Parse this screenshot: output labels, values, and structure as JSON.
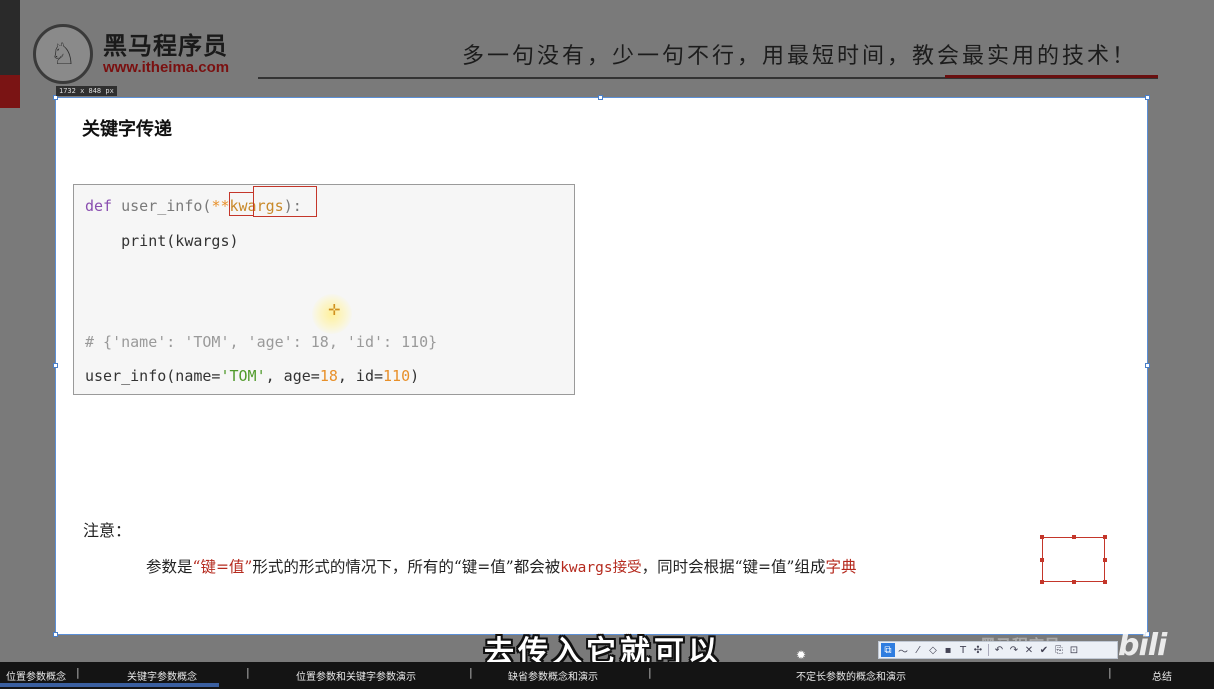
{
  "header": {
    "logo_title": "黑马程序员",
    "logo_url": "www.itheima.com",
    "slogan": "多一句没有，少一句不行，用最短时间，教会最实用的技术！",
    "size_tag": "1732 x 848 px"
  },
  "slide": {
    "title": "关键字传递",
    "code": {
      "line1": {
        "def": "def",
        "name": " user_info",
        "open": "(",
        "stars": "**",
        "param": "kwargs",
        "close": "):"
      },
      "line2": "    print(kwargs)",
      "line3": "# {'name': 'TOM', 'age': 18, 'id': 110}",
      "line4": {
        "a": "user_info(name=",
        "s1": "'TOM'",
        "b": ", age=",
        "n1": "18",
        "c": ", id=",
        "n2": "110",
        "d": ")"
      }
    },
    "note_label": "注意：",
    "note": {
      "p1": "参数是",
      "q1": "“键=值”",
      "p2": "形式的形式的情况下，所有的“键=值”都会被",
      "kw": "kwargs接受",
      "p3": "，同时会根据“键=值”组",
      "end1": "成",
      "end2": "字典"
    }
  },
  "subtitle": "去传入它就可以",
  "watermark": "黑马程序员",
  "bili": "bili",
  "toolbar": {
    "buttons": [
      "⧉",
      "〜",
      "⁄",
      "◇",
      "▪",
      "T",
      "✣",
      "↶",
      "↷",
      "✕",
      "✔",
      "⎘",
      "⊡"
    ]
  },
  "chapters": [
    "位置参数概念",
    "关键字参数概念",
    "位置参数和关键字参数演示",
    "缺省参数概念和演示",
    "不定长参数的概念和演示",
    "总结"
  ],
  "progress_fraction": 0.18
}
